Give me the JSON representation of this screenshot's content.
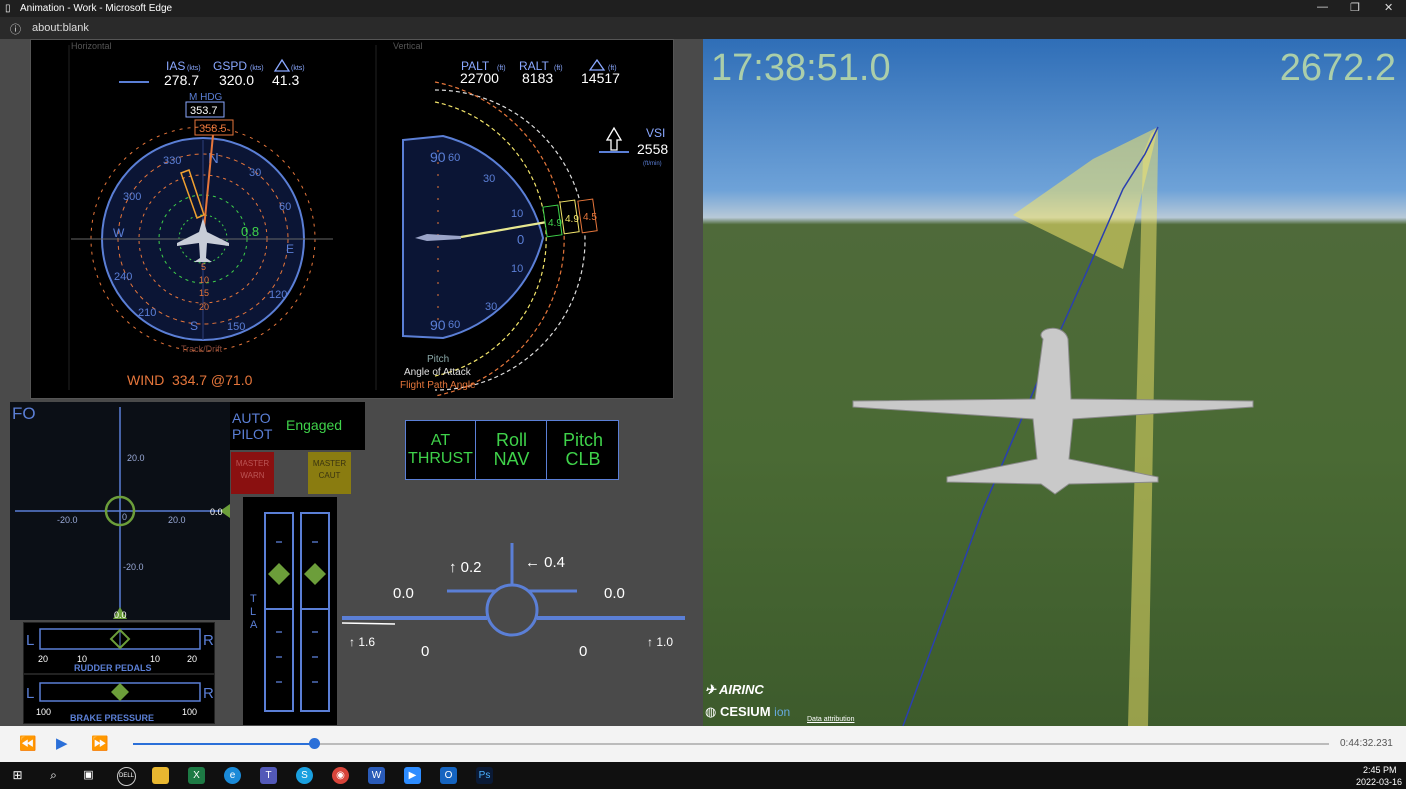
{
  "window": {
    "title": "Animation - Work - Microsoft Edge",
    "url": "about:blank"
  },
  "nd": {
    "horizontal_label": "Horizontal",
    "vertical_label": "Vertical",
    "ias_label": "IAS",
    "ias_unit": "(kts)",
    "ias": "278.7",
    "gspd_label": "GSPD",
    "gspd_unit": "(kts)",
    "gspd": "320.0",
    "delta_unit": "(kts)",
    "delta": "41.3",
    "mhdg_label": "M HDG",
    "mhdg": "353.7",
    "track": "358.5",
    "drift": "0.8",
    "compass": {
      "n": "N",
      "e": "E",
      "s": "S",
      "w": "W",
      "r30": "30",
      "r60": "60",
      "r120": "120",
      "r150": "150",
      "r210": "210",
      "r240": "240",
      "r300": "300",
      "r330": "330"
    },
    "range_rings": [
      "5",
      "10",
      "15",
      "20"
    ],
    "track_drift_label": "Track/Drift",
    "wind_label": "WIND",
    "wind": "334.7 @71.0",
    "palt_label": "PALT",
    "palt_unit": "(ft)",
    "palt": "22700",
    "ralt_label": "RALT",
    "ralt_unit": "(ft)",
    "ralt": "8183",
    "dalt_unit": "(ft)",
    "dalt": "14517",
    "vsi_label": "VSI",
    "vsi": "2558",
    "vsi_unit": "(ft/min)",
    "pitch_scale": {
      "top_90": "90",
      "top_60": "60",
      "p30": "30",
      "p10": "10",
      "zero": "0",
      "m10": "10",
      "m30": "30",
      "bot_90": "90",
      "bot_60": "60"
    },
    "pitch_tag": "4.9",
    "aoa_tag": "4.9",
    "fpa_tag": "4.5",
    "pitch_label": "Pitch",
    "aoa_label": "Angle of Attack",
    "fpa_label": "Flight Path Angle"
  },
  "fo": {
    "label": "FO",
    "y_top": "20.0",
    "y_bot": "-20.0",
    "x_left": "-20.0",
    "x_right": "20.0",
    "center": "0",
    "right_val": "0.0",
    "bottom_val": "0.0"
  },
  "rudder": {
    "left": "L",
    "right": "R",
    "l20": "20",
    "l10": "10",
    "r10": "10",
    "r20": "20",
    "label": "RUDDER PEDALS"
  },
  "brake": {
    "left": "L",
    "right": "R",
    "l100": "100",
    "r100": "100",
    "label": "BRAKE PRESSURE"
  },
  "autopilot": {
    "label_line1": "AUTO",
    "label_line2": "PILOT",
    "status": "Engaged"
  },
  "master_warn": {
    "line1": "MASTER",
    "line2": "WARN"
  },
  "master_caut": {
    "line1": "MASTER",
    "line2": "CAUT"
  },
  "fma": [
    {
      "line1": "AT",
      "line2": "THRUST"
    },
    {
      "line1": "Roll",
      "line2": "NAV"
    },
    {
      "line1": "Pitch",
      "line2": "CLB"
    }
  ],
  "tla_label": "T\nL\nA",
  "controls": {
    "elev_up": "↑ 0.2",
    "rudder_left": "← 0.4",
    "left_aileron": "0.0",
    "right_aileron": "0.0",
    "left_spoiler": "↑ 1.6",
    "right_spoiler": "↑ 1.0",
    "left_flap": "0",
    "right_flap": "0"
  },
  "scene": {
    "time": "17:38:51.0",
    "value": "2672.2",
    "logo_airinc": "AIRINC",
    "logo_cesium": "CESIUM",
    "logo_ion": "ion",
    "attribution": "Data attribution"
  },
  "player": {
    "time": "0:44:32.231",
    "progress": 0.151
  },
  "taskbar": {
    "time": "2:45 PM",
    "date": "2022-03-16"
  },
  "colors": {
    "nd_blue": "#5b7fd6",
    "green": "#3fd24a",
    "orange": "#e6763b",
    "yellow": "#f2e46a"
  }
}
